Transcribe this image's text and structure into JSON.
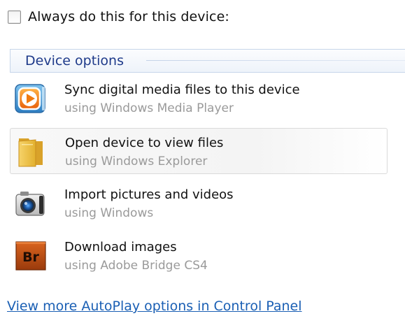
{
  "always_checkbox": {
    "label": "Always do this for this device:",
    "checked": false
  },
  "group": {
    "title": "Device options"
  },
  "options": [
    {
      "title": "Sync digital media files to this device",
      "subtitle": "using Windows Media Player",
      "icon": "windows-media-player-icon"
    },
    {
      "title": "Open device to view files",
      "subtitle": "using Windows Explorer",
      "icon": "folder-icon",
      "highlighted": true
    },
    {
      "title": "Import pictures and videos",
      "subtitle": "using Windows",
      "icon": "camera-icon"
    },
    {
      "title": "Download images",
      "subtitle": "using Adobe Bridge CS4",
      "icon": "adobe-bridge-icon",
      "icon_text": "Br"
    }
  ],
  "footer": {
    "link_text": "View more AutoPlay options in Control Panel"
  },
  "colors": {
    "link": "#1a5fb4",
    "group_title": "#1e3a8a",
    "subtitle": "#9a9a9a",
    "bridge_brand": "#b84a12"
  }
}
